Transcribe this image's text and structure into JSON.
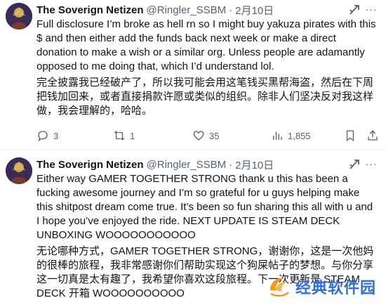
{
  "tweets": [
    {
      "name": "The Soverign Netizen",
      "handle": "@Ringler_SSBM",
      "sep": "·",
      "date": "2月10日",
      "text_en": "Full disclosure I’m broke as hell rn so I might buy yakuza pirates with this $ and then either add the funds back next week or make a direct donation to make a wish or a similar org. Unless people are adamantly opposed to me doing that, which I’d understand lol.",
      "text_zh": "完全披露我已经破产了，所以我可能会用这笔钱买黑帮海盗，然后在下周把钱加回来，或者直接捐款许愿或类似的组织。除非人们坚决反对我这样做，我会理解的，哈哈。",
      "replies": "3",
      "retweets": "1",
      "likes": "35",
      "views": "1,855"
    },
    {
      "name": "The Soverign Netizen",
      "handle": "@Ringler_SSBM",
      "sep": "·",
      "date": "2月10日",
      "text_en": "Either way GAMER TOGETHER STRONG thank u this has been a fucking awesome journey and I’m so grateful for u guys helping make this shitpost dream come true. It’s been so fun sharing this all with u and I hope you’ve enjoyed the ride. NEXT UPDATE IS STEAM DECK UNBOXING WOOOOOOOOOOO",
      "text_zh": "无论哪种方式，GAMER TOGETHER STRONG，谢谢你，这是一次他妈的很棒的旅程，我非常感谢你们帮助实现这个狗屎帖子的梦想。与你分享这一切真是太有趣了，我希望你喜欢这段旅程。下一次更新是 STEAM DECK 开箱 WOOOOOOOOOO"
    }
  ],
  "watermark": "经典软件园",
  "colors": {
    "text": "#0f1419",
    "muted": "#536471",
    "divider": "#eff3f4",
    "watermark": "#2f6fe0"
  },
  "icons": [
    "reply-icon",
    "retweet-icon",
    "like-icon",
    "views-icon",
    "bookmark-icon",
    "share-icon",
    "grok-icon",
    "more-icon"
  ]
}
